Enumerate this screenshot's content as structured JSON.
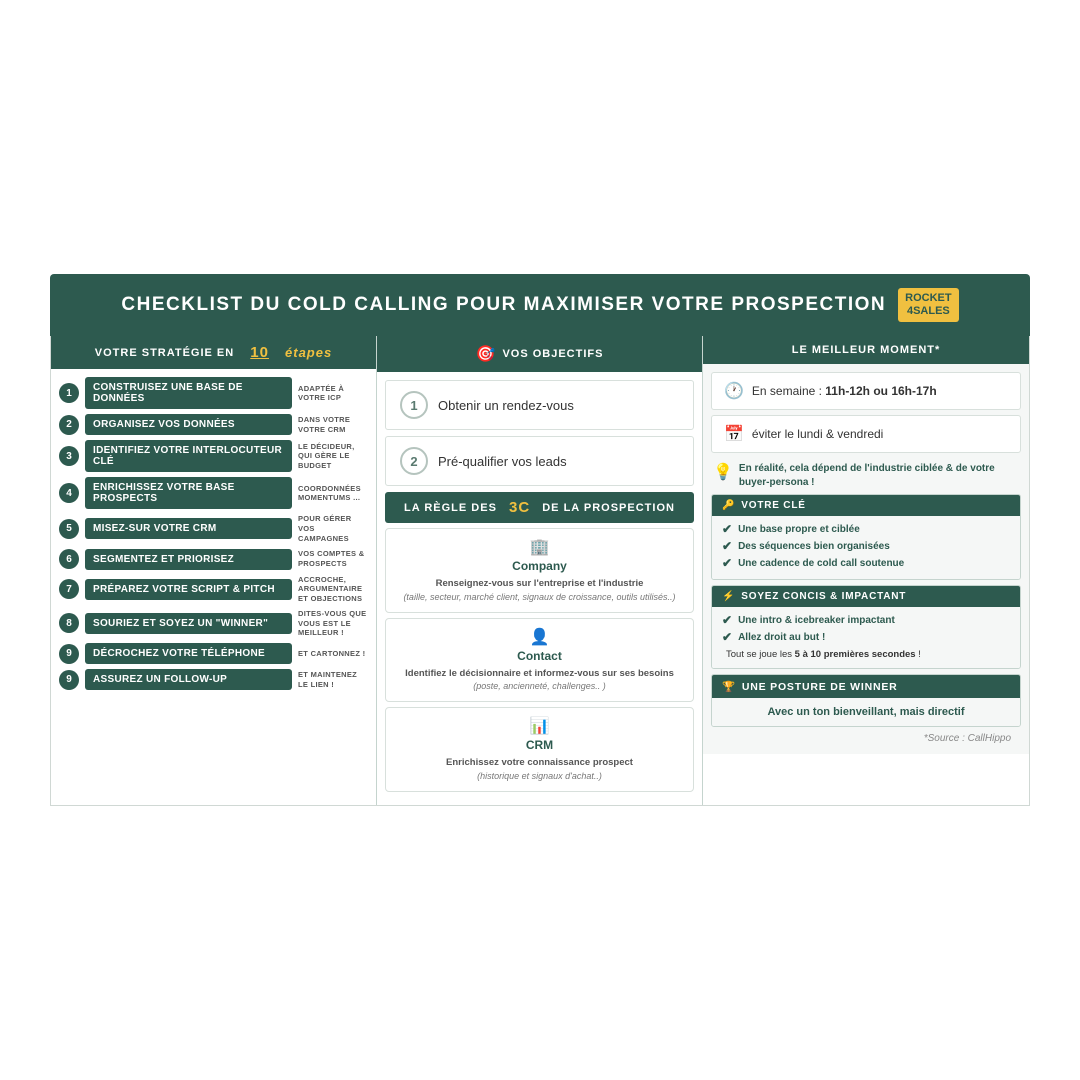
{
  "header": {
    "title": "CHECKLIST DU COLD CALLING POUR MAXIMISER VOTRE PROSPECTION",
    "logo_line1": "ROCKET",
    "logo_line2": "4SALES"
  },
  "left_col": {
    "header": "VOTRE STRATÉGIE EN",
    "header_num": "10",
    "header_suffix": "étapes",
    "steps": [
      {
        "num": "1",
        "label": "Construisez une base de données",
        "note": "ADAPTÉE À VOTRE ICP"
      },
      {
        "num": "2",
        "label": "Organisez vos données",
        "note": "DANS VOTRE VOTRE CRM"
      },
      {
        "num": "3",
        "label": "Identifiez votre interlocuteur clé",
        "note": "LE DÉCIDEUR, QUI GÈRE LE BUDGET"
      },
      {
        "num": "4",
        "label": "Enrichissez votre base prospects",
        "note": "COORDONNÉES MOMENTUMS ..."
      },
      {
        "num": "5",
        "label": "Misez-sur votre CRM",
        "note": "POUR GÉRER VOS CAMPAGNES"
      },
      {
        "num": "6",
        "label": "Segmentez et priorisez",
        "note": "VOS COMPTES & PROSPECTS"
      },
      {
        "num": "7",
        "label": "Préparez votre script & pitch",
        "note": "ACCROCHE, ARGUMENTAIRE ET OBJECTIONS"
      },
      {
        "num": "8",
        "label": "Souriez et soyez un \"winner\"",
        "note": "DITES-VOUS QUE VOUS EST LE MEILLEUR !"
      },
      {
        "num": "9",
        "label": "Décrochez votre téléphone",
        "note": "ET CARTONNEZ !"
      },
      {
        "num": "9",
        "label": "Assurez un follow-up",
        "note": "ET MAINTENEZ LE LIEN !"
      }
    ]
  },
  "mid_col": {
    "header": "VOS OBJECTIFS",
    "objectives": [
      {
        "num": "1",
        "text": "Obtenir un rendez-vous"
      },
      {
        "num": "2",
        "text": "Pré-qualifier vos leads"
      }
    ],
    "regle_header_pre": "LA RÈGLE DES",
    "regle_num": "3C",
    "regle_header_post": "DE LA PROSPECTION",
    "cards": [
      {
        "icon": "🏢",
        "title": "Company",
        "desc_bold": "Renseignez-vous sur l'entreprise et l'industrie",
        "desc_italic": "(taille, secteur, marché client, signaux de croissance, outils utilisés..)"
      },
      {
        "icon": "👤",
        "title": "Contact",
        "desc_bold": "Identifiez le décisionnaire et informez-vous sur ses besoins",
        "desc_italic": "(poste, ancienneté, challenges.. )"
      },
      {
        "icon": "📊",
        "title": "CRM",
        "desc_bold": "Enrichissez votre connaissance prospect",
        "desc_italic": "(historique et signaux d'achat..)"
      }
    ]
  },
  "right_col": {
    "header": "LE MEILLEUR MOMENT*",
    "time_items": [
      {
        "icon": "🕐",
        "text_pre": "En semaine : ",
        "text_bold": "11h-12h ou 16h-17h",
        "text_post": ""
      },
      {
        "icon": "📅",
        "text_pre": "",
        "text_bold": "",
        "text_post": "éviter le lundi & vendredi"
      }
    ],
    "tip": "En réalité, cela dépend de l'industrie ciblée & de votre buyer-persona !",
    "votre_cle_header": "VOTRE CLÉ",
    "votre_cle_items": [
      "Une base propre et ciblée",
      "Des séquences bien organisées",
      "Une cadence de cold call soutenue"
    ],
    "concis_header": "SOYEZ CONCIS & IMPACTANT",
    "concis_items": [
      "Une intro & icebreaker impactant",
      "Allez droit au but !"
    ],
    "seconds_note_pre": "Tout se joue les ",
    "seconds_bold": "5 à 10 premières secondes",
    "seconds_note_post": " !",
    "winner_header": "UNE POSTURE DE WINNER",
    "winner_body": "Avec un ton bienveillant, mais directif",
    "source": "*Source : CallHippo"
  }
}
